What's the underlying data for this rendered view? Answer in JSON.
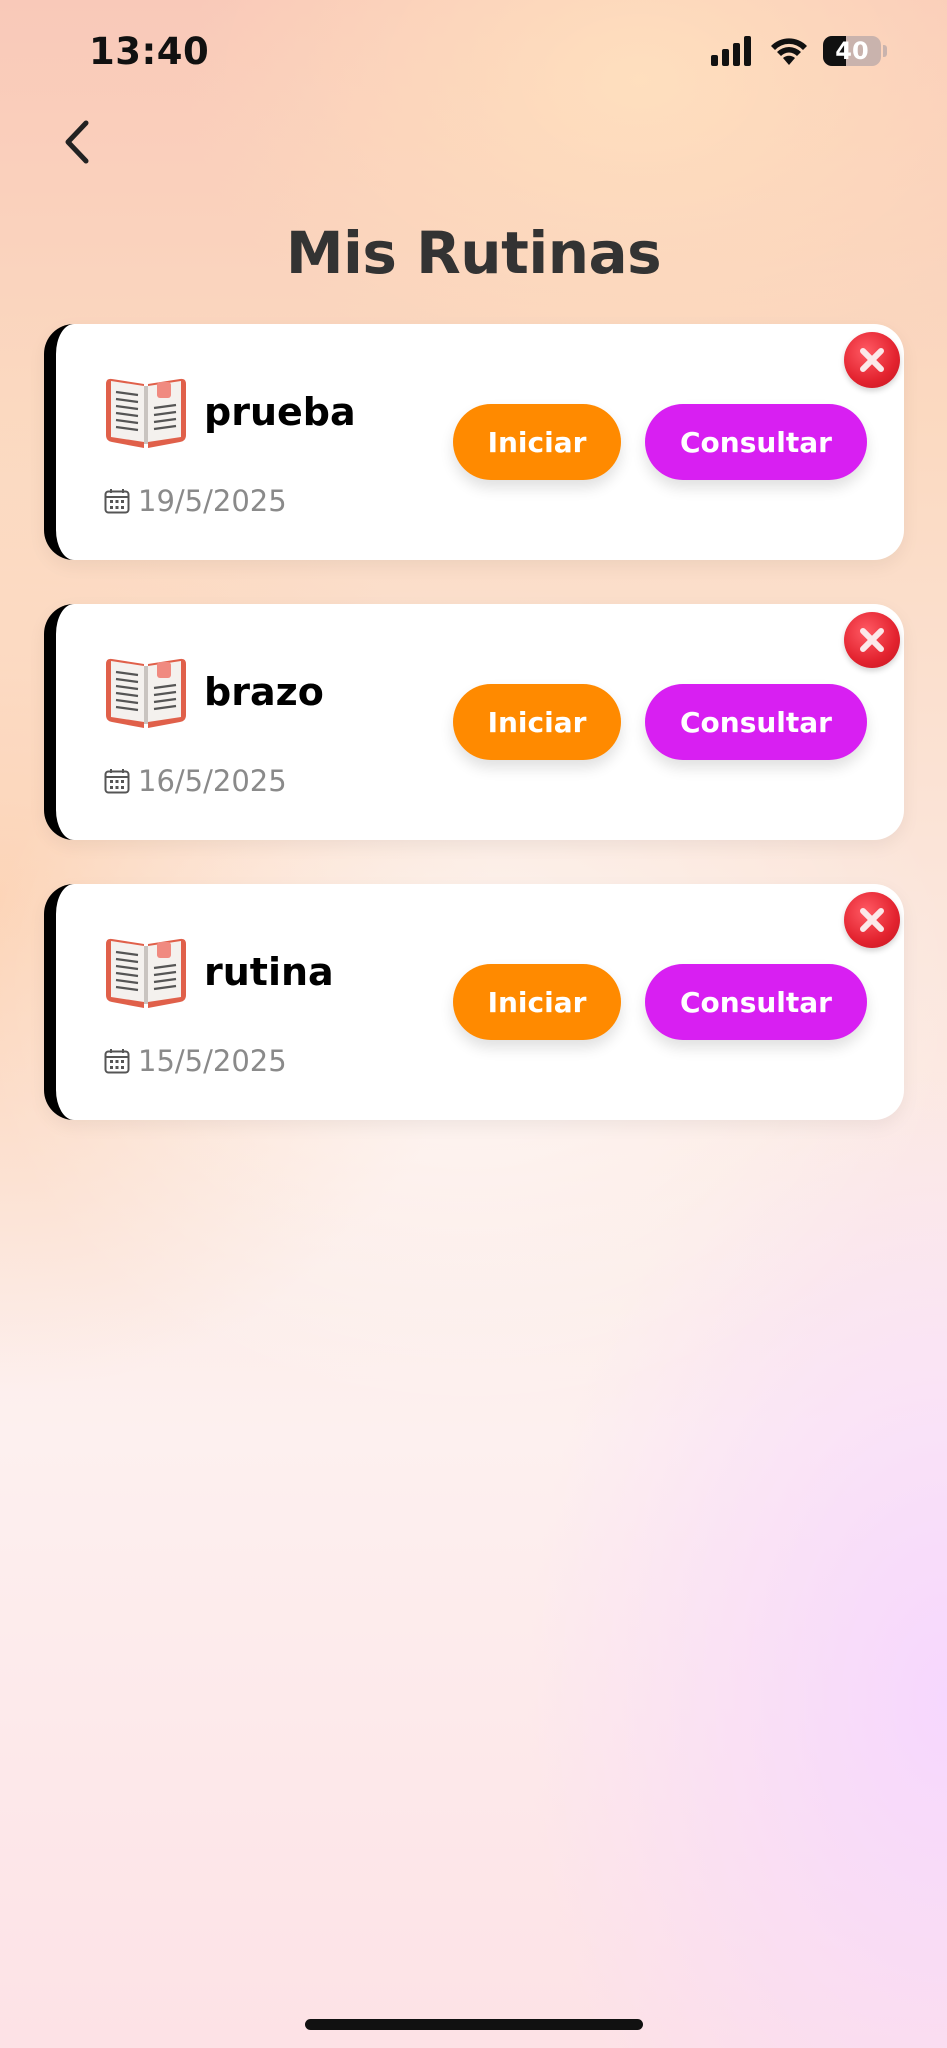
{
  "status_bar": {
    "time": "13:40",
    "battery_level": "40",
    "battery_fraction": 0.4,
    "icons": [
      "cellular-signal-icon",
      "wifi-icon",
      "battery-icon"
    ]
  },
  "header": {
    "back_icon": "chevron-left-icon",
    "title": "Mis Rutinas"
  },
  "colors": {
    "start_button": "#ff8a00",
    "consult_button": "#d81ff2",
    "delete_button": "#e3232f",
    "title_text": "#333333",
    "date_text": "#8a8a8a"
  },
  "routines": [
    {
      "name": "prueba",
      "date": "19/5/2025",
      "start_label": "Iniciar",
      "consult_label": "Consultar",
      "icon": "book-icon",
      "date_icon": "calendar-icon",
      "delete_icon": "close-icon"
    },
    {
      "name": "brazo",
      "date": "16/5/2025",
      "start_label": "Iniciar",
      "consult_label": "Consultar",
      "icon": "book-icon",
      "date_icon": "calendar-icon",
      "delete_icon": "close-icon"
    },
    {
      "name": "rutina",
      "date": "15/5/2025",
      "start_label": "Iniciar",
      "consult_label": "Consultar",
      "icon": "book-icon",
      "date_icon": "calendar-icon",
      "delete_icon": "close-icon"
    }
  ]
}
